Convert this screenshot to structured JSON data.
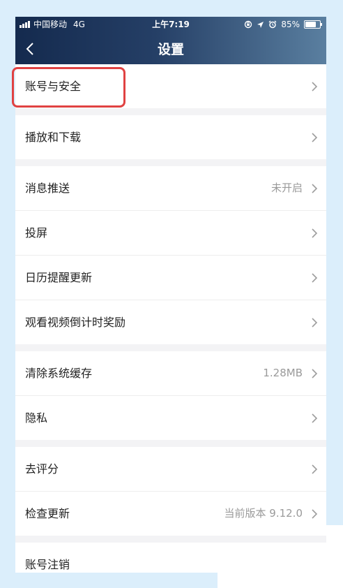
{
  "status_bar": {
    "carrier": "中国移动",
    "network": "4G",
    "time": "上午7:19",
    "battery": "85%",
    "battery_level": 0.85
  },
  "header": {
    "title": "设置"
  },
  "sections": [
    {
      "items": [
        {
          "label": "账号与安全"
        }
      ]
    },
    {
      "items": [
        {
          "label": "播放和下载"
        }
      ]
    },
    {
      "items": [
        {
          "label": "消息推送",
          "value": "未开启"
        },
        {
          "label": "投屏"
        },
        {
          "label": "日历提醒更新"
        },
        {
          "label": "观看视频倒计时奖励"
        }
      ]
    },
    {
      "items": [
        {
          "label": "清除系统缓存",
          "value": "1.28MB"
        },
        {
          "label": "隐私"
        }
      ]
    },
    {
      "items": [
        {
          "label": "去评分"
        },
        {
          "label": "检查更新",
          "value": "当前版本 9.12.0"
        }
      ]
    },
    {
      "items": [
        {
          "label": "账号注销"
        }
      ]
    }
  ],
  "colors": {
    "highlight": "#e04242",
    "header_start": "#142a4e",
    "header_end": "#5a7fa0",
    "frame": "#dbeefb"
  }
}
